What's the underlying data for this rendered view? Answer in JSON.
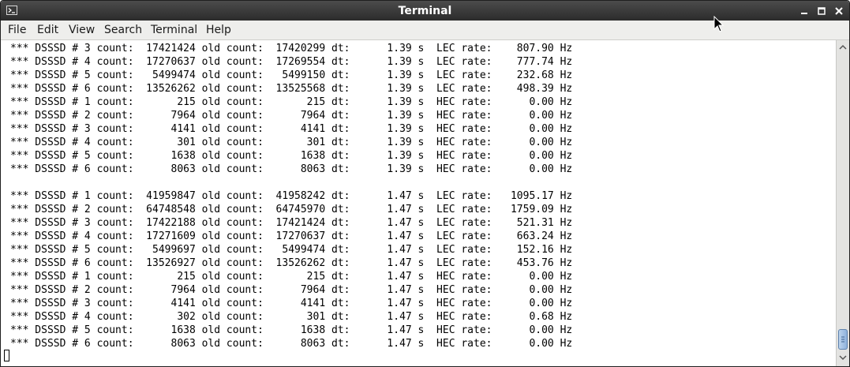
{
  "window": {
    "title": "Terminal"
  },
  "menu": [
    "File",
    "Edit",
    "View",
    "Search",
    "Terminal",
    "Help"
  ],
  "lines": [
    "*** DSSSD # 3 count:  17421424 old count:  17420299 dt:      1.39 s  LEC rate:    807.90 Hz",
    "*** DSSSD # 4 count:  17270637 old count:  17269554 dt:      1.39 s  LEC rate:    777.74 Hz",
    "*** DSSSD # 5 count:   5499474 old count:   5499150 dt:      1.39 s  LEC rate:    232.68 Hz",
    "*** DSSSD # 6 count:  13526262 old count:  13525568 dt:      1.39 s  LEC rate:    498.39 Hz",
    "*** DSSSD # 1 count:       215 old count:       215 dt:      1.39 s  HEC rate:      0.00 Hz",
    "*** DSSSD # 2 count:      7964 old count:      7964 dt:      1.39 s  HEC rate:      0.00 Hz",
    "*** DSSSD # 3 count:      4141 old count:      4141 dt:      1.39 s  HEC rate:      0.00 Hz",
    "*** DSSSD # 4 count:       301 old count:       301 dt:      1.39 s  HEC rate:      0.00 Hz",
    "*** DSSSD # 5 count:      1638 old count:      1638 dt:      1.39 s  HEC rate:      0.00 Hz",
    "*** DSSSD # 6 count:      8063 old count:      8063 dt:      1.39 s  HEC rate:      0.00 Hz",
    "",
    "*** DSSSD # 1 count:  41959847 old count:  41958242 dt:      1.47 s  LEC rate:   1095.17 Hz",
    "*** DSSSD # 2 count:  64748548 old count:  64745970 dt:      1.47 s  LEC rate:   1759.09 Hz",
    "*** DSSSD # 3 count:  17422188 old count:  17421424 dt:      1.47 s  LEC rate:    521.31 Hz",
    "*** DSSSD # 4 count:  17271609 old count:  17270637 dt:      1.47 s  LEC rate:    663.24 Hz",
    "*** DSSSD # 5 count:   5499697 old count:   5499474 dt:      1.47 s  LEC rate:    152.16 Hz",
    "*** DSSSD # 6 count:  13526927 old count:  13526262 dt:      1.47 s  LEC rate:    453.76 Hz",
    "*** DSSSD # 1 count:       215 old count:       215 dt:      1.47 s  HEC rate:      0.00 Hz",
    "*** DSSSD # 2 count:      7964 old count:      7964 dt:      1.47 s  HEC rate:      0.00 Hz",
    "*** DSSSD # 3 count:      4141 old count:      4141 dt:      1.47 s  HEC rate:      0.00 Hz",
    "*** DSSSD # 4 count:       302 old count:       301 dt:      1.47 s  HEC rate:      0.68 Hz",
    "*** DSSSD # 5 count:      1638 old count:      1638 dt:      1.47 s  HEC rate:      0.00 Hz",
    "*** DSSSD # 6 count:      8063 old count:      8063 dt:      1.47 s  HEC rate:      0.00 Hz",
    ""
  ],
  "icons": {
    "app": "terminal-icon",
    "minimize": "minimize-icon",
    "maximize": "maximize-icon",
    "close": "close-icon",
    "scroll_up": "arrow-up-icon",
    "scroll_down": "arrow-down-icon",
    "pointer": "mouse-pointer-icon"
  },
  "colors": {
    "titlebar": "#333333",
    "menubar": "#eeeeec",
    "terminal_bg": "#ffffff",
    "terminal_fg": "#000000",
    "scroll_thumb": "#8fb2dc"
  }
}
